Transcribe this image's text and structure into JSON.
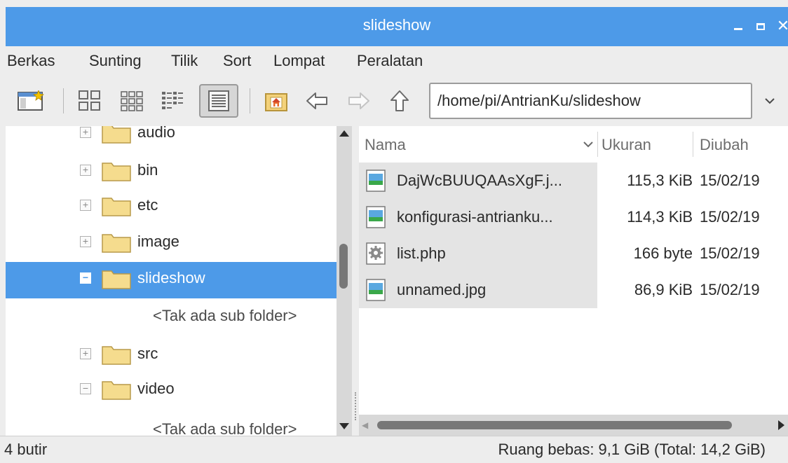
{
  "window": {
    "title": "slideshow"
  },
  "menu": [
    "Berkas",
    "Sunting",
    "Tilik",
    "Sort",
    "Lompat",
    "Peralatan"
  ],
  "toolbar": {
    "icons": [
      "new-window-icon",
      "icon-view-icon",
      "thumbnail-view-icon",
      "compact-view-icon",
      "detailed-list-view-icon",
      "home-icon",
      "back-arrow-icon",
      "forward-arrow-icon",
      "up-arrow-icon",
      "chevron-down-icon"
    ],
    "active_view": "detailed-list-view",
    "address": "/home/pi/AntrianKu/slideshow"
  },
  "tree": {
    "items": [
      {
        "label": "audio",
        "expander": "+"
      },
      {
        "label": "bin",
        "expander": "+"
      },
      {
        "label": "etc",
        "expander": "+"
      },
      {
        "label": "image",
        "expander": "+"
      },
      {
        "label": "slideshow",
        "expander": "−",
        "selected": true
      },
      {
        "label": "<Tak ada sub folder>"
      },
      {
        "label": "src",
        "expander": "+"
      },
      {
        "label": "video",
        "expander": "−"
      },
      {
        "label": "<Tak ada sub folder>"
      }
    ]
  },
  "list": {
    "columns": [
      "Nama",
      "Ukuran",
      "Diubah"
    ],
    "files": [
      {
        "name": "DajWcBUUQAAsXgF.j...",
        "size": "115,3 KiB",
        "modified": "15/02/19",
        "icon": "image-file-icon"
      },
      {
        "name": "konfigurasi-antrianku...",
        "size": "114,3 KiB",
        "modified": "15/02/19",
        "icon": "image-file-icon"
      },
      {
        "name": "list.php",
        "size": "166 byte",
        "modified": "15/02/19",
        "icon": "script-file-icon"
      },
      {
        "name": "unnamed.jpg",
        "size": "86,9 KiB",
        "modified": "15/02/19",
        "icon": "image-file-icon"
      }
    ]
  },
  "status": {
    "left": "4 butir",
    "right": "Ruang bebas: 9,1 GiB (Total: 14,2 GiB)"
  },
  "colors": {
    "accent": "#4d9ae8",
    "folder": "#f3d77a"
  }
}
